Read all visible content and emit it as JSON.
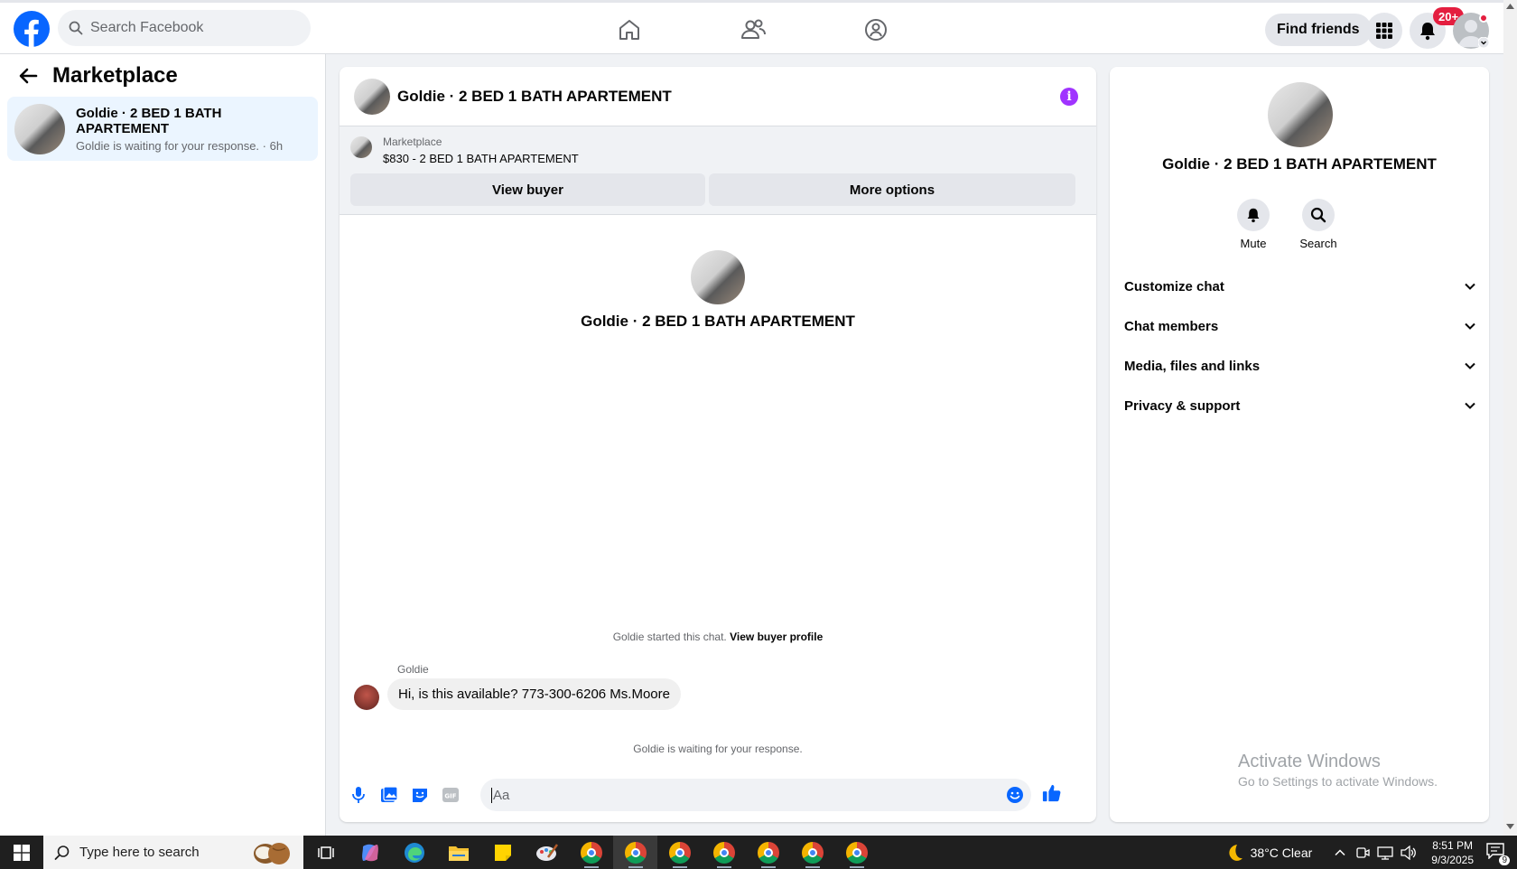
{
  "topnav": {
    "search_placeholder": "Search Facebook",
    "find_friends_label": "Find friends",
    "notifications_badge": "20+",
    "brand_color": "#0866ff"
  },
  "left": {
    "title": "Marketplace",
    "conversation": {
      "name": "Goldie · 2 BED 1 BATH APARTEMENT",
      "subtitle": "Goldie is waiting for your response. · 6h"
    }
  },
  "chat": {
    "header_title": "Goldie · 2 BED 1 BATH APARTEMENT",
    "marketplace_label": "Marketplace",
    "listing": "$830 - 2 BED 1 BATH APARTEMENT",
    "view_buyer_label": "View buyer",
    "more_options_label": "More options",
    "hero_name": "Goldie · 2 BED 1 BATH APARTEMENT",
    "started_text": "Goldie started this chat.",
    "view_buyer_profile_label": "View buyer profile",
    "sender": "Goldie",
    "message": "Hi, is this available? 773-300-6206 Ms.Moore",
    "waiting_text": "Goldie is waiting for your response.",
    "composer_placeholder": "Aa",
    "accent_color": "#0866ff"
  },
  "right": {
    "name": "Goldie · 2 BED 1 BATH APARTEMENT",
    "mute_label": "Mute",
    "search_label": "Search",
    "sections": [
      "Customize chat",
      "Chat members",
      "Media, files and links",
      "Privacy & support"
    ],
    "activate_title": "Activate Windows",
    "activate_sub": "Go to Settings to activate Windows."
  },
  "taskbar": {
    "search_placeholder": "Type here to search",
    "weather": "38°C  Clear",
    "time": "8:51 PM",
    "date": "9/3/2025",
    "notification_count": "9"
  }
}
